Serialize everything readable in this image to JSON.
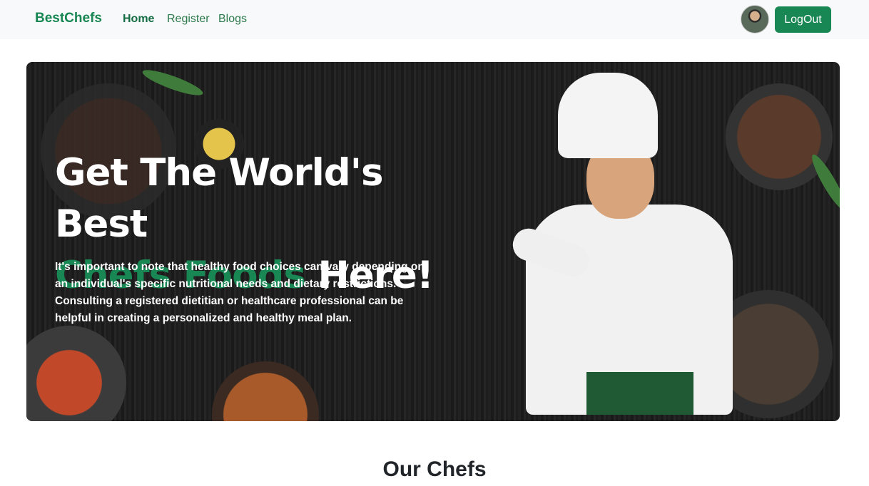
{
  "navbar": {
    "brand": "BestChefs",
    "links": [
      {
        "label": "Home",
        "active": true
      },
      {
        "label": "Register",
        "active": false
      },
      {
        "label": "Blogs",
        "active": false
      }
    ],
    "logout_label": "LogOut"
  },
  "hero": {
    "title_line1": "Get The World's Best",
    "title_accent": "Chefs Foods",
    "title_rest": " Here!",
    "description": "It's important to note that healthy food choices can vary depending on an individual's specific nutritional needs and dietary restrictions. Consulting a registered dietitian or healthcare professional can be helpful in creating a personalized and healthy meal plan."
  },
  "sections": {
    "chefs_title": "Our Chefs"
  },
  "colors": {
    "accent": "#198754",
    "navbar_bg": "#f8f9fa",
    "hero_bg": "#1e1e1e"
  }
}
